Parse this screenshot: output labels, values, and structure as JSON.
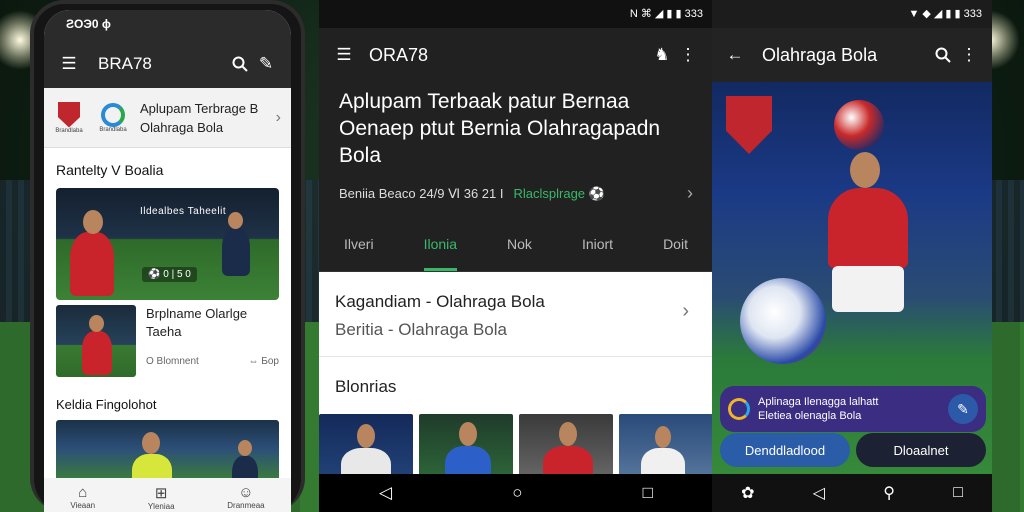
{
  "phone1": {
    "status_time": "ƧOЭ0 ϕ",
    "app_title": "BRA78",
    "banner": {
      "line1": "Aplupam Terbrage B",
      "line2": "Olahraga Bola",
      "logo1_caption": "Brandlaba",
      "logo2_caption": "Brandlaba"
    },
    "section1": "Rantelty V Boalia",
    "card": {
      "title": "Ildealbes Taheelit",
      "score": "⚽ 0 | 5 0"
    },
    "item": {
      "title_line1": "Brplname Olarlge",
      "title_line2": "Taeha",
      "time": "O Blomnent",
      "meta": "⇔ Ƃop"
    },
    "section2": "Keldia Fingolohot",
    "bottom_nav": [
      {
        "icon": "home-icon",
        "label": "Vieaan"
      },
      {
        "icon": "grid-icon",
        "label": "Yleniaa"
      },
      {
        "icon": "person-icon",
        "label": "Dranmeaa"
      }
    ]
  },
  "phone2": {
    "status_icons": "N ⌘ ◢ ▮ ▮ 333",
    "app_title": "ORA78",
    "headline": "Aplupam Terbaak patur Bernaa Oenaep ptut Bernia Olahragapadn Bola",
    "meta_left": "Beniia Beaco 24/9 Ⅵ 36 21 I",
    "meta_green": "Rlaclsplrage ⚽",
    "tabs": [
      "Ilveri",
      "Ilonia",
      "Nok",
      "Iniort",
      "Doit"
    ],
    "active_tab": "Ilonia",
    "list_item": {
      "title": "Kagandiam - Olahraga Bola",
      "subtitle": "Beritia - Olahraga Bola"
    },
    "section": "Blonrias",
    "nav": [
      "◁",
      "○",
      "□"
    ]
  },
  "phone3": {
    "status_icons": "▼ ◆ ◢ ▮ ▮ 333",
    "app_title": "Olahraga Bola",
    "info": {
      "line1": "Aplinaga Ilenagga lalhatt",
      "line2": "Eletiea olenagla Bola"
    },
    "button_primary": "Denddladlood",
    "button_secondary": "Dloaalnet",
    "nav": [
      "✿",
      "◁",
      "⚲",
      "□"
    ]
  },
  "colors": {
    "accent_green": "#39b868",
    "appbar_dark": "#2b2b2b",
    "banner_purple": "#3a2d82",
    "button_blue": "#2a5ca8",
    "jersey_red": "#c9242c"
  }
}
